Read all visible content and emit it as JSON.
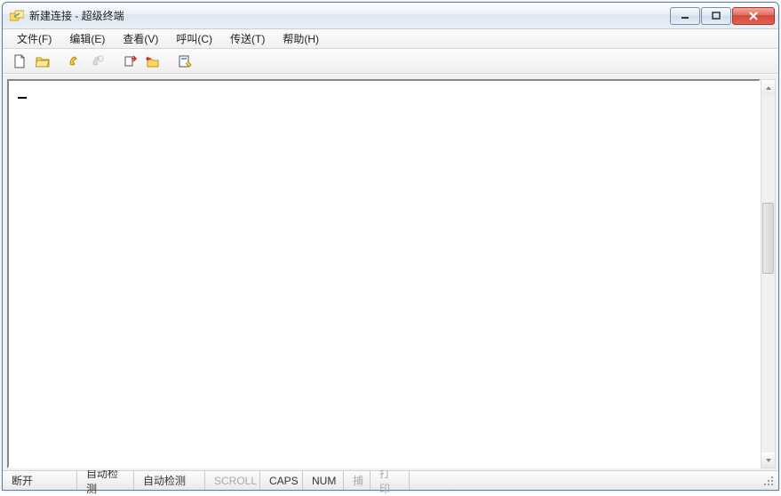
{
  "window": {
    "title": "新建连接 - 超级终端"
  },
  "menubar": {
    "items": [
      {
        "label": "文件(F)"
      },
      {
        "label": "编辑(E)"
      },
      {
        "label": "查看(V)"
      },
      {
        "label": "呼叫(C)"
      },
      {
        "label": "传送(T)"
      },
      {
        "label": "帮助(H)"
      }
    ]
  },
  "toolbar": {
    "icons": {
      "new": "new-file-icon",
      "open": "open-folder-icon",
      "connect": "phone-icon",
      "disconnect": "disconnect-icon",
      "send": "send-icon",
      "receive": "receive-icon",
      "properties": "properties-icon"
    }
  },
  "terminal": {
    "content": ""
  },
  "statusbar": {
    "connection": "断开",
    "autodetect1": "自动检测",
    "autodetect2": "自动检测",
    "scroll": "SCROLL",
    "caps": "CAPS",
    "num": "NUM",
    "capture": "捕",
    "print": "打印"
  }
}
